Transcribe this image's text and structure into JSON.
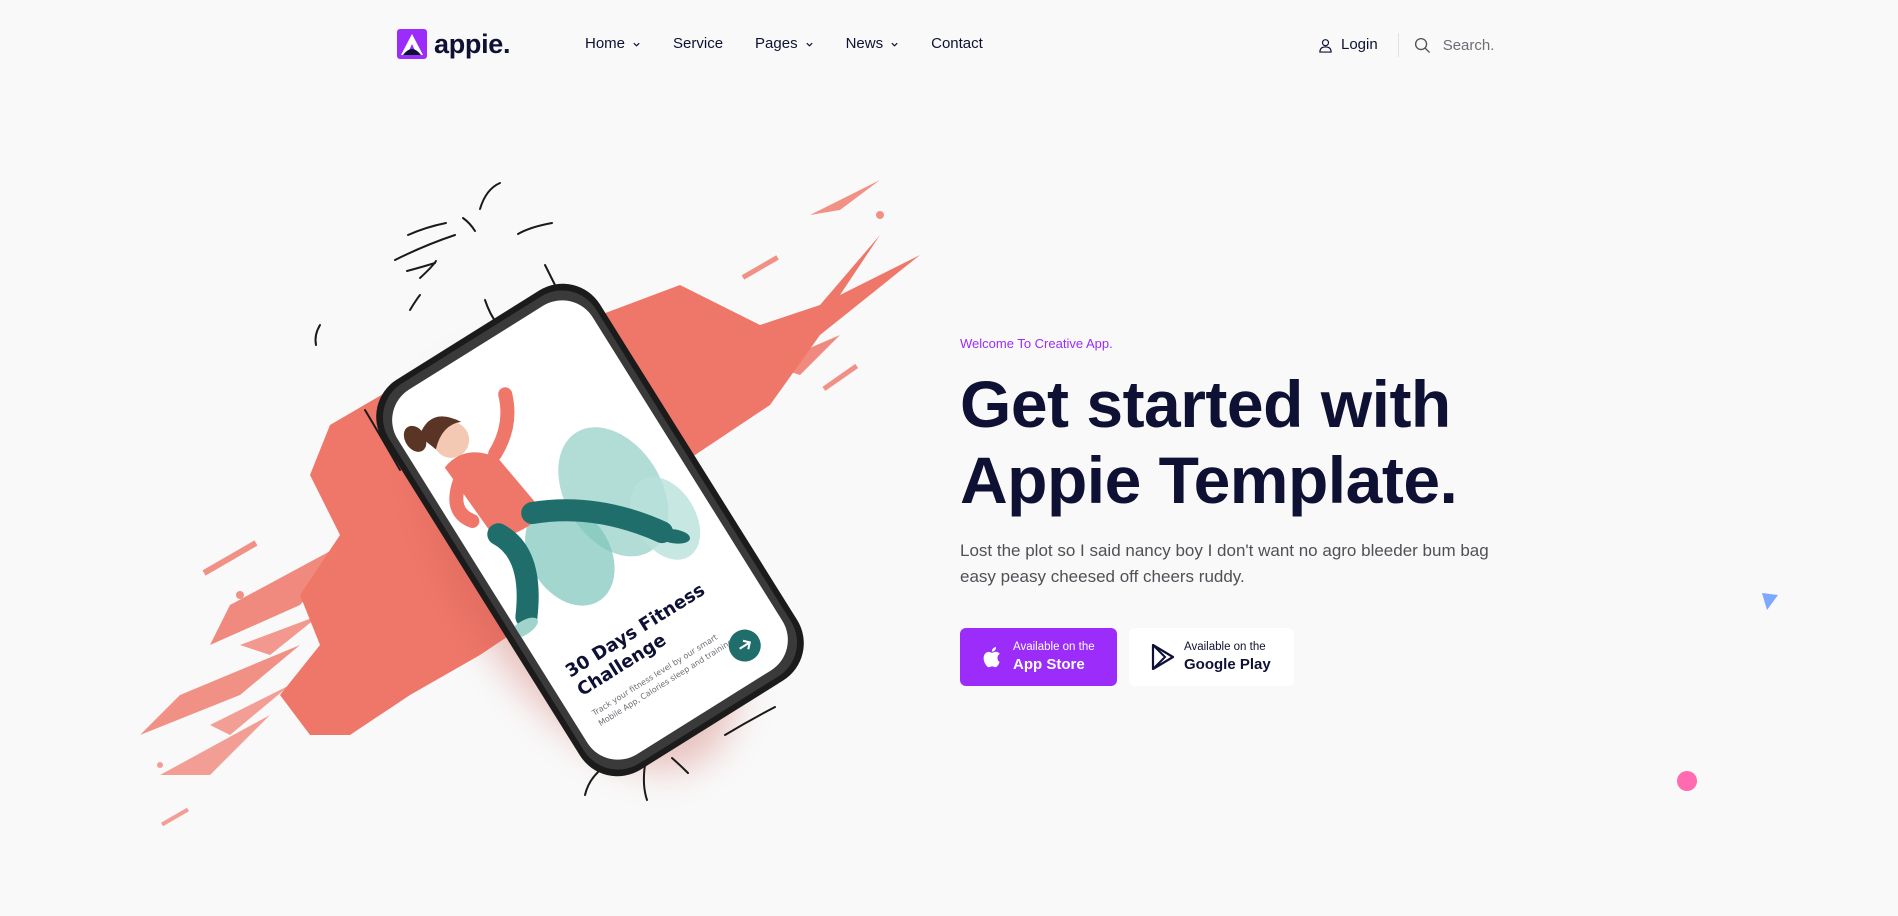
{
  "brand": {
    "name": "appie.",
    "accent": "#9b2cfa"
  },
  "nav": {
    "items": [
      {
        "label": "Home",
        "has_dropdown": true
      },
      {
        "label": "Service",
        "has_dropdown": false
      },
      {
        "label": "Pages",
        "has_dropdown": true
      },
      {
        "label": "News",
        "has_dropdown": true
      },
      {
        "label": "Contact",
        "has_dropdown": false
      }
    ]
  },
  "header": {
    "login_label": "Login",
    "search_placeholder": "Search."
  },
  "hero": {
    "eyebrow": "Welcome To Creative App.",
    "headline": "Get started with Appie Template.",
    "subtext": "Lost the plot so I said nancy boy I don't want no agro bleeder bum bag easy peasy cheesed off cheers ruddy.",
    "buttons": {
      "app_store": {
        "small": "Available on the",
        "big": "App Store"
      },
      "google_play": {
        "small": "Available on the",
        "big": "Google Play"
      }
    }
  },
  "phone_screen": {
    "title": "30 Days Fitness Challenge",
    "body": "Track your fitness level by our smart Mobile App, Calories sleep and training..."
  },
  "colors": {
    "headline": "#0e1133",
    "body_text": "#505056",
    "paint_splash": "#ef7769",
    "phone_button": "#1f6e6b",
    "triangle": "#7ea8ff",
    "dot": "#ff6ab0"
  },
  "icons": [
    "chevron-down-icon",
    "user-icon",
    "search-icon",
    "apple-icon",
    "google-play-icon",
    "arrow-icon"
  ]
}
